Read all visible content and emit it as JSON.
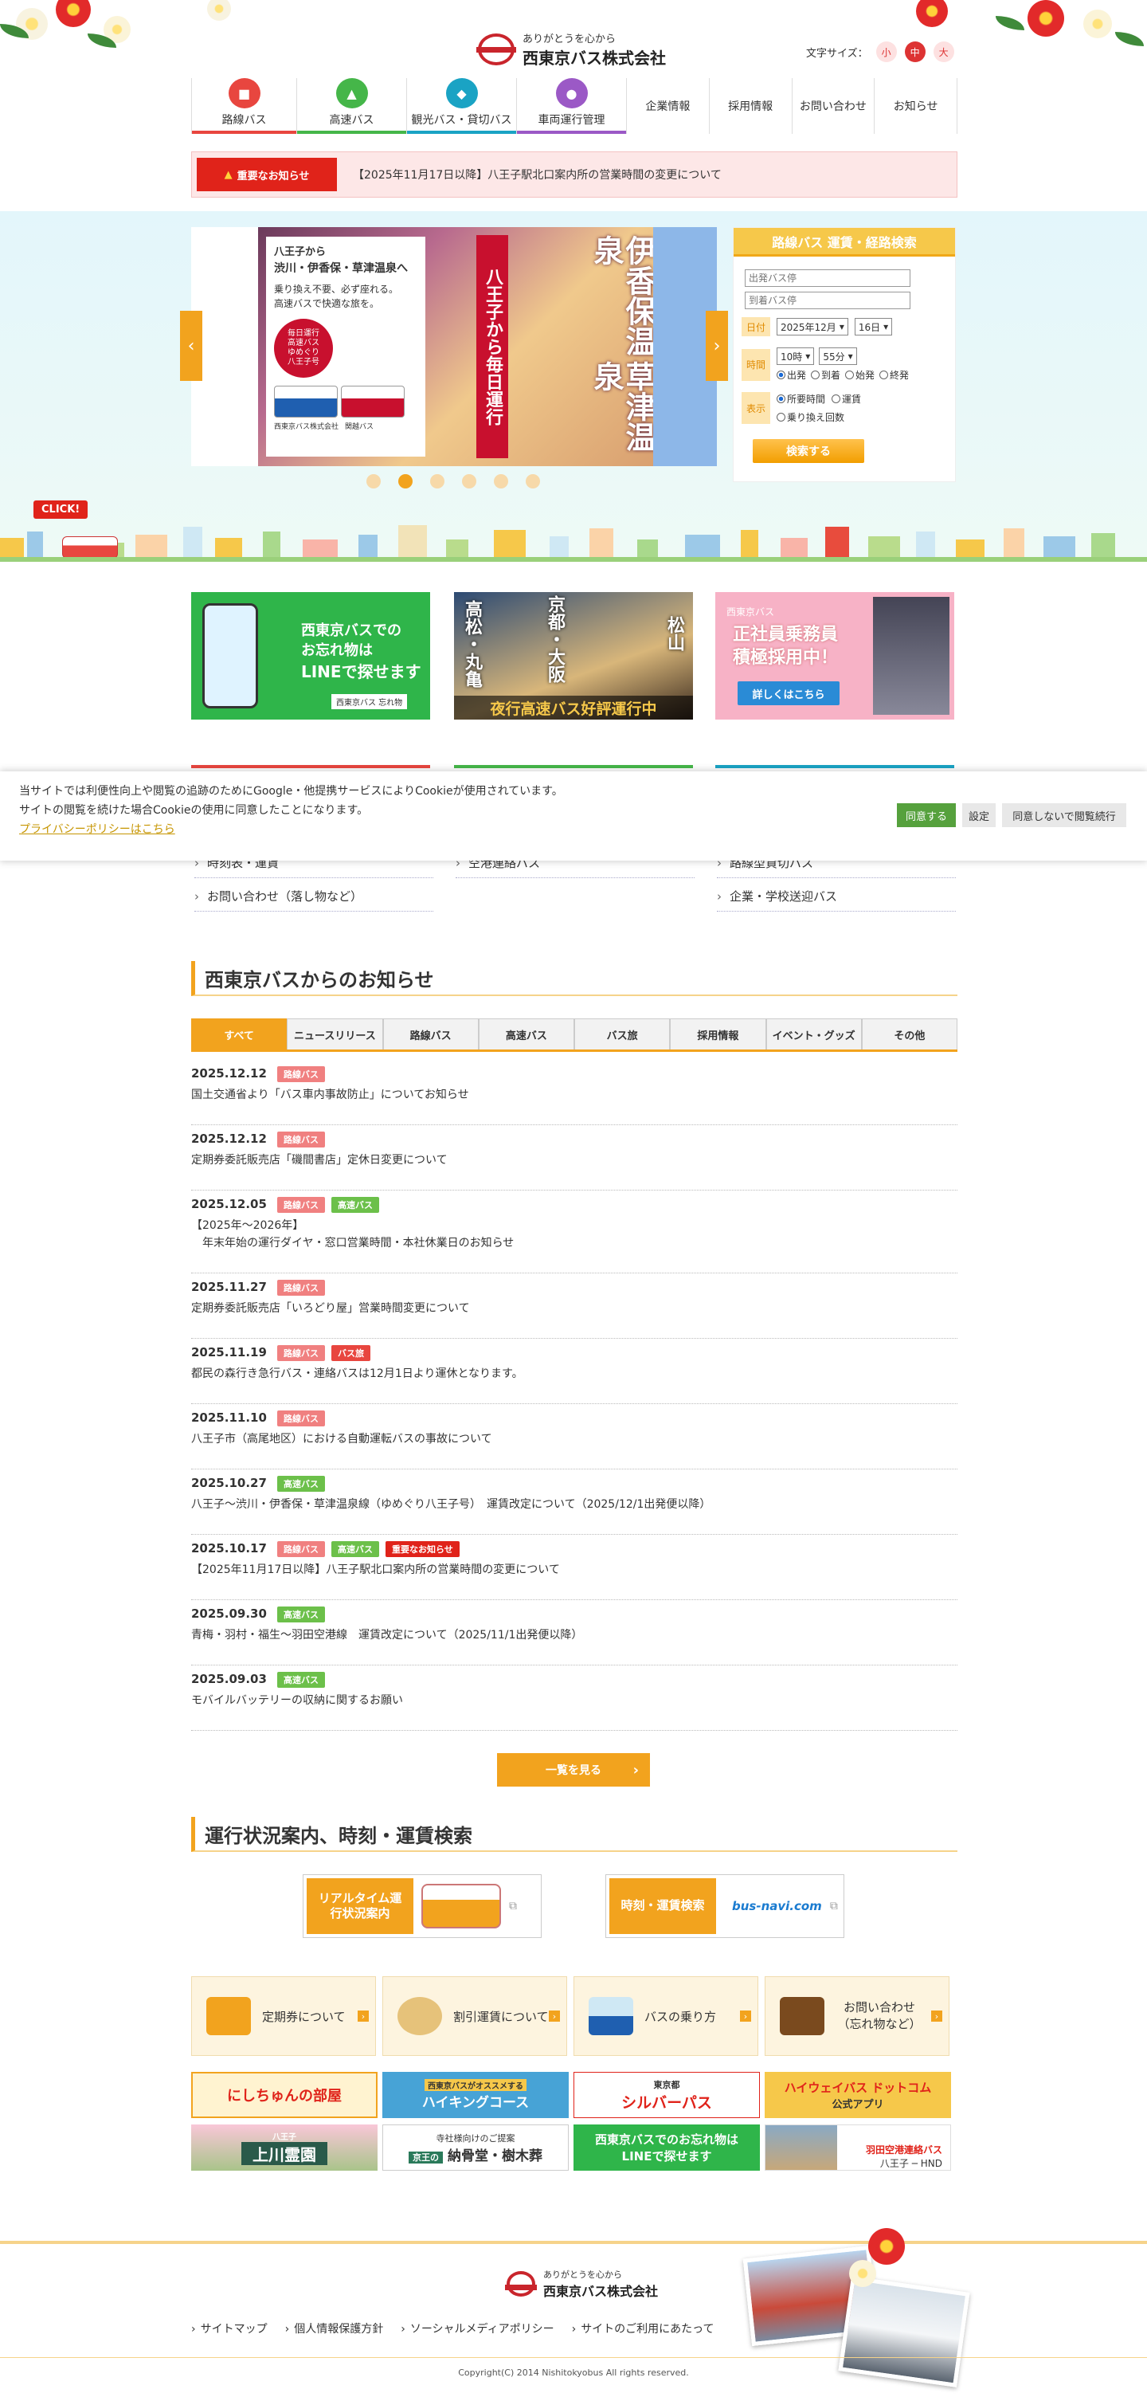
{
  "header": {
    "logo_sub": "ありがとうを心から",
    "logo_name": "西東京バス株式会社",
    "font_size_label": "文字サイズ：",
    "font_sizes": [
      "小",
      "中",
      "大"
    ]
  },
  "nav": {
    "icon_items": [
      {
        "label": "路線バス",
        "color": "#e8463f"
      },
      {
        "label": "高速バス",
        "color": "#45b649"
      },
      {
        "label": "観光バス・貸切バス",
        "color": "#1aa3c4"
      },
      {
        "label": "車両運行管理",
        "color": "#9b59c6"
      }
    ],
    "text_items": [
      "企業情報",
      "採用情報",
      "お問い合わせ",
      "お知らせ"
    ]
  },
  "notice": {
    "badge": "重要なお知らせ",
    "text": "【2025年11月17日以降】八王子駅北口案内所の営業時間の変更について"
  },
  "slider": {
    "card_line1": "八王子から",
    "card_line2": "渋川・伊香保・草津温泉へ",
    "card_line3": "乗り換え不要、必ず座れる。",
    "card_line4": "高速バスで快適な旅を。",
    "card_badge1": "毎日運行",
    "card_badge2": "高速バス",
    "card_badge3": "ゆめぐり",
    "card_badge4": "八王子号",
    "title_col1": "伊香保温泉",
    "title_col2": "草津温泉",
    "subtitle": "八王子から毎日運行",
    "company": "西東京バス株式会社",
    "company2": "関越バス",
    "dots": 6,
    "active_dot": 1
  },
  "search": {
    "title": "路線バス 運賃・経路検索",
    "from_placeholder": "出発バス停",
    "to_placeholder": "到着バス停",
    "date_label": "日付",
    "month": "2025年12月",
    "day": "16日",
    "time_label": "時間",
    "hour": "10時",
    "minute": "55分",
    "time_options": [
      "出発",
      "到着",
      "始発",
      "終発"
    ],
    "display_label": "表示",
    "display_options": [
      "所要時間",
      "運賃",
      "乗り換え回数"
    ],
    "button": "検索する"
  },
  "town": {
    "click": "CLICK!"
  },
  "banners": {
    "line_text1": "西東京バスでの",
    "line_text2": "お忘れ物は",
    "line_text3": "LINEで探せます",
    "line_tag": "西東京バス 忘れ物",
    "night_city1": "高松・丸亀",
    "night_city2": "京都・大阪",
    "night_city3": "松山",
    "night_caption": "夜行高速バス好評運行中",
    "recruit_small": "西東京バス",
    "recruit_line1": "正社員乗務員",
    "recruit_line2": "積極採用中！",
    "recruit_button": "詳しくはこちら"
  },
  "cookie": {
    "line1": "当サイトでは利便性向上や閲覧の追跡のためにGoogle・他提携サービスによりCookieが使用されています。",
    "line2": "サイトの閲覧を続けた場合Cookieの使用に同意したことになります。",
    "policy": "プライバシーポリシーはこちら",
    "agree": "同意する",
    "settings": "設定",
    "disagree": "同意しないで閲覧続行"
  },
  "menu_links": {
    "col1": [
      "時刻表・運賃",
      "お問い合わせ（落し物など）"
    ],
    "col2": [
      "空港連絡バス"
    ],
    "col3": [
      "路線型貸切バス",
      "企業・学校送迎バス"
    ]
  },
  "news_section": {
    "title": "西東京バスからのお知らせ",
    "tabs": [
      "すべて",
      "ニュースリリース",
      "路線バス",
      "高速バス",
      "バス旅",
      "採用情報",
      "イベント・グッズ",
      "その他"
    ],
    "items": [
      {
        "date": "2025.12.12",
        "tags": [
          {
            "t": "路線バス",
            "c": "#f08080"
          }
        ],
        "text": "国土交通省より「バス車内事故防止」についてお知らせ"
      },
      {
        "date": "2025.12.12",
        "tags": [
          {
            "t": "路線バス",
            "c": "#f08080"
          }
        ],
        "text": "定期券委託販売店「磯間書店」定休日変更について"
      },
      {
        "date": "2025.12.05",
        "tags": [
          {
            "t": "路線バス",
            "c": "#f08080"
          },
          {
            "t": "高速バス",
            "c": "#6cc04a"
          }
        ],
        "text": "【2025年～2026年】",
        "text2": "年末年始の運行ダイヤ・窓口営業時間・本社休業日のお知らせ"
      },
      {
        "date": "2025.11.27",
        "tags": [
          {
            "t": "路線バス",
            "c": "#f08080"
          }
        ],
        "text": "定期券委託販売店「いろどり屋」営業時間変更について"
      },
      {
        "date": "2025.11.19",
        "tags": [
          {
            "t": "路線バス",
            "c": "#f08080"
          },
          {
            "t": "バス旅",
            "c": "#e8463f"
          }
        ],
        "text": "都民の森行き急行バス・連絡バスは12月1日より運休となります。"
      },
      {
        "date": "2025.11.10",
        "tags": [
          {
            "t": "路線バス",
            "c": "#f08080"
          }
        ],
        "text": "八王子市（高尾地区）における自動運転バスの事故について"
      },
      {
        "date": "2025.10.27",
        "tags": [
          {
            "t": "高速バス",
            "c": "#6cc04a"
          }
        ],
        "text": "八王子～渋川・伊香保・草津温泉線（ゆめぐり八王子号）　運賃改定について（2025/12/1出発便以降）"
      },
      {
        "date": "2025.10.17",
        "tags": [
          {
            "t": "路線バス",
            "c": "#f08080"
          },
          {
            "t": "高速バス",
            "c": "#6cc04a"
          },
          {
            "t": "重要なお知らせ",
            "c": "#e0231a"
          }
        ],
        "text": "【2025年11月17日以降】八王子駅北口案内所の営業時間の変更について"
      },
      {
        "date": "2025.09.30",
        "tags": [
          {
            "t": "高速バス",
            "c": "#6cc04a"
          }
        ],
        "text": "青梅・羽村・福生～羽田空港線　運賃改定について（2025/11/1出発便以降）"
      },
      {
        "date": "2025.09.03",
        "tags": [
          {
            "t": "高速バス",
            "c": "#6cc04a"
          }
        ],
        "text": "モバイルバッテリーの収納に関するお願い"
      }
    ],
    "more": "一覧を見る"
  },
  "status_section": {
    "title": "運行状況案内、時刻・運賃検索",
    "realtime": "リアルタイム運行状況案内",
    "timetable": "時刻・運賃検索",
    "busnavi": "bus-navi.com"
  },
  "info_cards": [
    "定期券について",
    "割引運賃について",
    "バスの乗り方",
    "お問い合わせ（忘れ物など）"
  ],
  "small_banners": {
    "nishichun": "にしちゅんの部屋",
    "hiking_small": "西東京バスがオススメする",
    "hiking": "ハイキングコース",
    "silver_small": "東京都",
    "silver": "シルバーパス",
    "highway": "ハイウェイバス ドットコム",
    "highway_sub": "公式アプリ",
    "kamikawa_small": "八王子",
    "kamikawa": "上川霊園",
    "noukotsu_small": "寺社様向けのご提案",
    "noukotsu_tag": "京王の",
    "noukotsu": "納骨堂・樹木葬",
    "line_banner1": "西東京バスでのお忘れ物は",
    "line_banner2": "LINEで探せます",
    "airport": "羽田空港連絡バス",
    "airport_sub": "八王子",
    "airport_hnd": "HND"
  },
  "footer": {
    "links": [
      "サイトマップ",
      "個人情報保護方針",
      "ソーシャルメディアポリシー",
      "サイトのご利用にあたって"
    ],
    "copyright": "Copyright(C) 2014 Nishitokyobus All rights reserved."
  }
}
